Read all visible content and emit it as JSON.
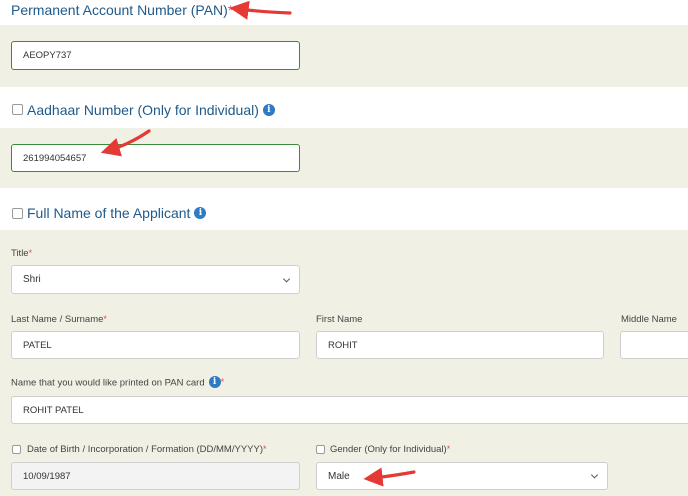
{
  "pan": {
    "title": "Permanent Account Number (PAN)",
    "required_mark": "*",
    "value": "AEOPY737"
  },
  "aadhaar": {
    "title": "Aadhaar Number (Only for Individual)",
    "info_icon": "i",
    "value": "261994054657"
  },
  "full_name": {
    "title": "Full Name of the Applicant",
    "info_icon": "i",
    "title_label": "Title",
    "title_value": "Shri",
    "last_name_label": "Last Name / Surname",
    "last_name_value": "PATEL",
    "first_name_label": "First Name",
    "first_name_value": "ROHIT",
    "middle_name_label": "Middle Name",
    "middle_name_value": ""
  },
  "pan_card_name": {
    "label": "Name that you would like printed on PAN card",
    "info_icon": "i",
    "value": "ROHIT PATEL"
  },
  "dob": {
    "label": "Date of Birth / Incorporation / Formation (DD/MM/YYYY)",
    "value": "10/09/1987"
  },
  "gender": {
    "label": "Gender (Only for Individual)",
    "value": "Male"
  },
  "req": "*",
  "colors": {
    "section_title": "#1f5a8a",
    "band_beige": "#f1f0e4",
    "valid_border": "#3c8a3c",
    "info_icon": "#2e7bc4",
    "arrow": "#e53935",
    "required": "#d9534f"
  }
}
